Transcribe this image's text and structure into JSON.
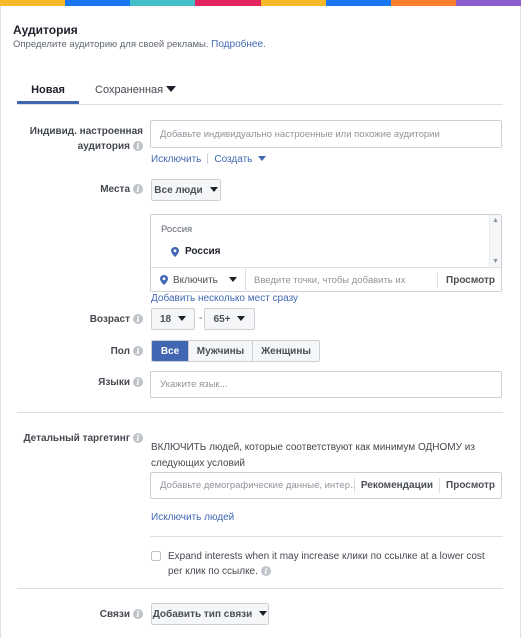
{
  "brand_colors": [
    "#f7b928",
    "#1877f2",
    "#44bec7",
    "#e4245f",
    "#f7b928",
    "#1877f2",
    "#ff7d2e",
    "#8c5ccc"
  ],
  "header": {
    "title": "Аудитория",
    "subtitle": "Определите аудиторию для своей рекламы.",
    "more_link": "Подробнее."
  },
  "tabs": [
    {
      "label": "Новая",
      "active": true
    },
    {
      "label": "Сохраненная",
      "active": false
    }
  ],
  "custom_audience": {
    "label_line1": "Индивид. настроенная",
    "label_line2": "аудитория",
    "placeholder": "Добавьте индивидуально настроенные или похожие аудитории",
    "exclude_link": "Исключить",
    "create_link": "Создать"
  },
  "locations": {
    "label": "Места",
    "dropdown": "Все люди",
    "country_header": "Россия",
    "selected_item": "Россия",
    "include_label": "Включить",
    "input_placeholder": "Введите точки, чтобы добавить их",
    "browse": "Просмотр",
    "bulk_link": "Добавить несколько мест сразу"
  },
  "age": {
    "label": "Возраст",
    "min": "18",
    "dash": "-",
    "max": "65+"
  },
  "gender": {
    "label": "Пол",
    "options": [
      "Все",
      "Мужчины",
      "Женщины"
    ],
    "selected": "Все"
  },
  "languages": {
    "label": "Языки",
    "placeholder": "Укажите язык..."
  },
  "detailed_targeting": {
    "label": "Детальный таргетинг",
    "description": "ВКЛЮЧИТЬ людей, которые соответствуют как минимум ОДНОМУ из следующих условий",
    "placeholder": "Добавьте демографические данные, интер...",
    "recommendations": "Рекомендации",
    "browse": "Просмотр",
    "exclude_link": "Исключить людей",
    "expand_text": "Expand interests when it may increase клики по ссылке at a lower cost per клик по ссылке.",
    "expand_checked": false
  },
  "connections": {
    "label": "Связи",
    "button": "Добавить тип связи"
  }
}
